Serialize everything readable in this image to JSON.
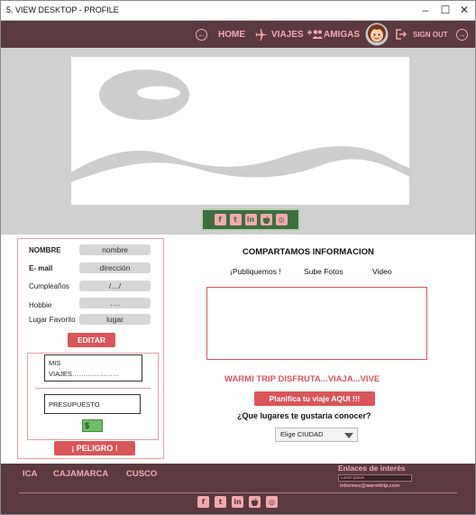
{
  "window": {
    "title": "5. VIEW DESKTOP - PROFILE",
    "minimize": "–",
    "maximize": "☐",
    "close": "✕"
  },
  "nav": {
    "back_icon": "left-arrow-circle-icon",
    "home": "HOME",
    "viajes": "VIAJES",
    "amigas": "AMIGAS",
    "sign_out": "SIGN OUT"
  },
  "hero": {
    "social_icons": [
      "f",
      "t",
      "in",
      "",
      "◎"
    ]
  },
  "profile": {
    "fields": [
      {
        "label": "NOMBRE",
        "value": "nombre"
      },
      {
        "label": "E- mail",
        "value": "dirección"
      },
      {
        "label": "Cumpleaños",
        "value": "/…/"
      },
      {
        "label": "Hobbie",
        "value": "…."
      },
      {
        "label": "Lugar Favorito",
        "value": "lugar"
      }
    ],
    "edit_button": "EDITAR",
    "mis_viajes_1": "MIS",
    "mis_viajes_2": "VIAJES…………………",
    "presupuesto": "PRESUPUESTO",
    "cash_symbol": "$",
    "danger_button": "¡ PELIGRO !"
  },
  "main": {
    "title": "COMPARTAMOS INFORMACION",
    "tabs": [
      "¡Publiquemos !",
      "Sube Fotos",
      "Video"
    ],
    "slogan": "WARMI TRIP DISFRUTA...VIAJA...VIVE",
    "plan_button": "Planifica tu viaje AQUI !!!",
    "question": "¿Que lugares te gustaria conocer?",
    "select_value": "Elige CIUDAD"
  },
  "footer": {
    "cities": [
      "ICA",
      "CAJAMARCA",
      "CUSCO"
    ],
    "links_title": "Enlaces de interès",
    "links_input": "Lorem Ipsum",
    "email": "informes@warmitrip.com",
    "social_icons": [
      "f",
      "t",
      "in",
      "",
      "◎"
    ]
  },
  "colors": {
    "header": "#5a3a3f",
    "accent": "#f2a9ae",
    "red": "#d9565a",
    "hero_bg": "#d0d0d0"
  }
}
